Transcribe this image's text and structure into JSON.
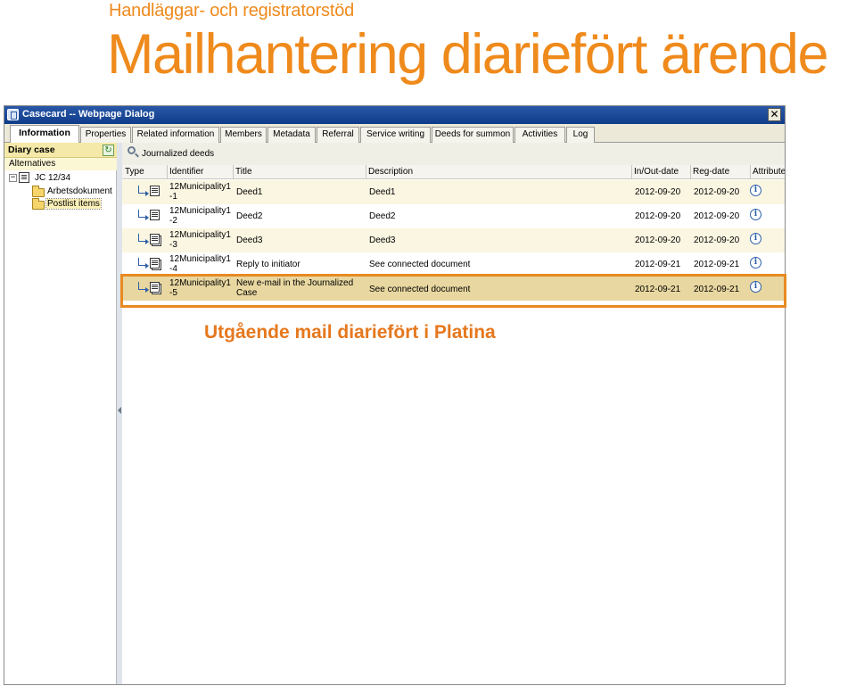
{
  "slide": {
    "subtitle": "Handläggar- och registratorstöd",
    "title": "Mailhantering diariefört ärende",
    "annotation": "Utgående mail diariefört i Platina",
    "accent_color": "#ef8a1c"
  },
  "dialog": {
    "title": "Casecard -- Webpage Dialog",
    "close_label": "✕",
    "tabs": [
      {
        "label": "Information",
        "active": true
      },
      {
        "label": "Properties"
      },
      {
        "label": "Related information"
      },
      {
        "label": "Members"
      },
      {
        "label": "Metadata"
      },
      {
        "label": "Referral"
      },
      {
        "label": "Service writing"
      },
      {
        "label": "Deeds for summon"
      },
      {
        "label": "Activities"
      },
      {
        "label": "Log"
      }
    ]
  },
  "left_pane": {
    "header": "Diary case",
    "refresh_icon": "refresh-icon",
    "alternatives": "Alternatives",
    "tree": {
      "root_toggle": "−",
      "root_label": "JC 12/34",
      "children": [
        {
          "label": "Arbetsdokument"
        },
        {
          "label": "Postlist items",
          "selected": true
        }
      ]
    }
  },
  "right_pane": {
    "header": "Journalized deeds",
    "columns": [
      "Type",
      "Identifier",
      "Title",
      "Description",
      "In/Out-date",
      "Reg-date",
      "Attribute"
    ],
    "rows": [
      {
        "id_line1": "12Municipality1",
        "id_line2": "-1",
        "title_line1": "Deed1",
        "title_line2": "",
        "description": "Deed1",
        "inout_date": "2012-09-20",
        "reg_date": "2012-09-20",
        "attribute_icon": "info-icon"
      },
      {
        "id_line1": "12Municipality1",
        "id_line2": "-2",
        "title_line1": "Deed2",
        "title_line2": "",
        "description": "Deed2",
        "inout_date": "2012-09-20",
        "reg_date": "2012-09-20",
        "attribute_icon": "info-icon"
      },
      {
        "id_line1": "12Municipality1",
        "id_line2": "-3",
        "title_line1": "Deed3",
        "title_line2": "",
        "description": "Deed3",
        "inout_date": "2012-09-20",
        "reg_date": "2012-09-20",
        "attribute_icon": "info-icon"
      },
      {
        "id_line1": "12Municipality1",
        "id_line2": "-4",
        "title_line1": "Reply to initiator",
        "title_line2": "",
        "description": "See connected document",
        "inout_date": "2012-09-21",
        "reg_date": "2012-09-21",
        "attribute_icon": "info-icon"
      },
      {
        "id_line1": "12Municipality1",
        "id_line2": "-5",
        "title_line1": "New e-mail in the Journalized",
        "title_line2": "Case",
        "description": "See connected document",
        "inout_date": "2012-09-21",
        "reg_date": "2012-09-21",
        "attribute_icon": "info-icon",
        "selected": true
      }
    ]
  }
}
